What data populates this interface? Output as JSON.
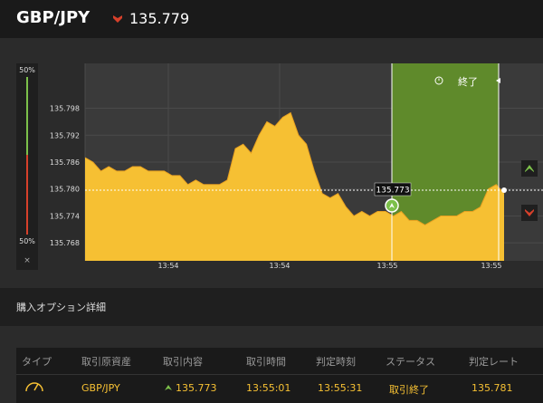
{
  "header": {
    "pair": "GBP/JPY",
    "price": "135.779",
    "trend": "down",
    "trend_color": "#d7402b"
  },
  "left_gauge": {
    "top_label": "50%",
    "bottom_label": "50%",
    "close": "×",
    "up_color": "#7cc04a",
    "down_color": "#d7402b"
  },
  "chart": {
    "y_ticks": [
      "135.798",
      "135.792",
      "135.786",
      "135.780",
      "135.774",
      "135.768"
    ],
    "x_ticks": [
      "13:54",
      "13:54",
      "13:55",
      "13:55"
    ],
    "entry_label": "135.773",
    "end_label": "終了",
    "clock_icon": "clock-icon",
    "fill_color": "#f6c033",
    "green_zone_color": "#5f8a2b"
  },
  "chart_data": {
    "type": "area",
    "series": [
      {
        "values": [
          135.787,
          135.786,
          135.784,
          135.785,
          135.784,
          135.784,
          135.785,
          135.785,
          135.784,
          135.784,
          135.784,
          135.783,
          135.783,
          135.781,
          135.782,
          135.781,
          135.781,
          135.781,
          135.782,
          135.789,
          135.79,
          135.788,
          135.792,
          135.795,
          135.794,
          135.796,
          135.797,
          135.792,
          135.79,
          135.784,
          135.779,
          135.778,
          135.779,
          135.776,
          135.774,
          135.775,
          135.774,
          135.775,
          135.775,
          135.774,
          135.775,
          135.773,
          135.773,
          135.772,
          135.773,
          135.774,
          135.774,
          135.774,
          135.775,
          135.775,
          135.776,
          135.78,
          135.781,
          135.779
        ]
      }
    ],
    "yrange": [
      135.764,
      135.808
    ],
    "entry": 135.773,
    "current": 135.779,
    "x_ticks": [
      "13:54",
      "13:54",
      "13:55",
      "13:55"
    ]
  },
  "side_buttons": {
    "up_icon": "chevron-up-icon",
    "down_icon": "chevron-down-icon",
    "up_color": "#7cc04a",
    "down_color": "#d7402b"
  },
  "section": {
    "title": "購入オプション詳細"
  },
  "table": {
    "headers": [
      "タイプ",
      "取引原資産",
      "取引内容",
      "取引時間",
      "判定時刻",
      "ステータス",
      "判定レート"
    ],
    "row": {
      "type_icon": "gauge-icon",
      "asset": "GBP/JPY",
      "direction": "up",
      "content": "135.773",
      "trade_time": "13:55:01",
      "judge_time": "13:55:31",
      "status": "取引終了",
      "rate": "135.781"
    }
  }
}
